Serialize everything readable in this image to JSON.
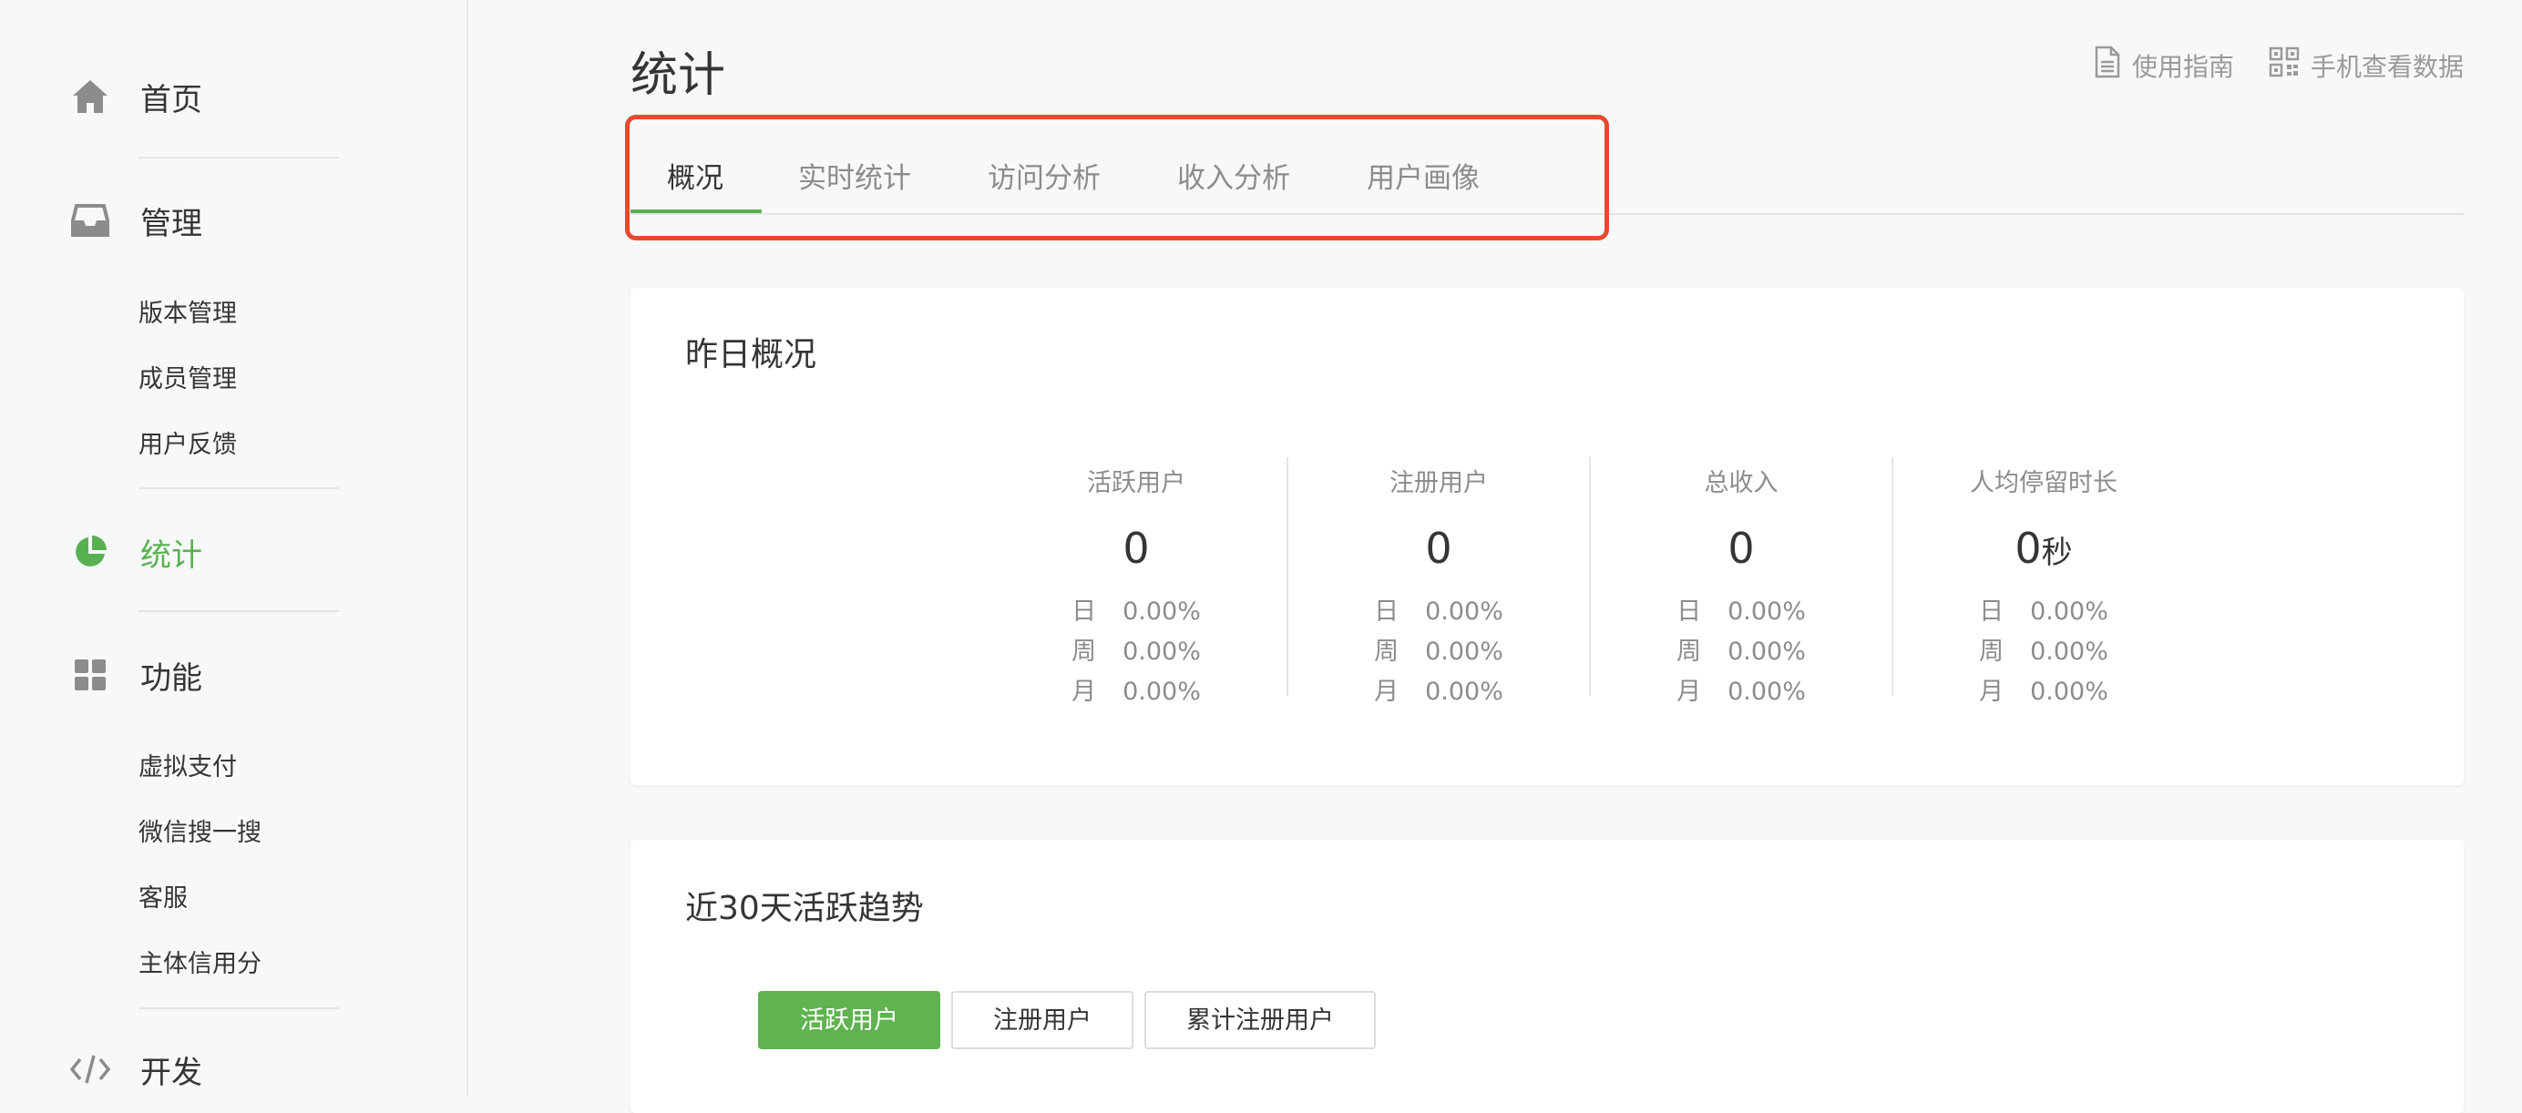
{
  "sidebar": {
    "home": "首页",
    "manage": "管理",
    "manage_items": [
      "版本管理",
      "成员管理",
      "用户反馈"
    ],
    "stats": "统计",
    "features": "功能",
    "feature_items": [
      "虚拟支付",
      "微信搜一搜",
      "客服",
      "主体信用分"
    ],
    "dev": "开发"
  },
  "header": {
    "title": "统计",
    "guide_link": "使用指南",
    "mobile_link": "手机查看数据"
  },
  "tabs": [
    "概况",
    "实时统计",
    "访问分析",
    "收入分析",
    "用户画像"
  ],
  "active_tab": 0,
  "overview": {
    "title": "昨日概况",
    "metrics": [
      {
        "label": "活跃用户",
        "value": "0",
        "unit": "",
        "day_k": "日",
        "day": "0.00%",
        "week_k": "周",
        "week": "0.00%",
        "month_k": "月",
        "month": "0.00%"
      },
      {
        "label": "注册用户",
        "value": "0",
        "unit": "",
        "day_k": "日",
        "day": "0.00%",
        "week_k": "周",
        "week": "0.00%",
        "month_k": "月",
        "month": "0.00%"
      },
      {
        "label": "总收入",
        "value": "0",
        "unit": "",
        "day_k": "日",
        "day": "0.00%",
        "week_k": "周",
        "week": "0.00%",
        "month_k": "月",
        "month": "0.00%"
      },
      {
        "label": "人均停留时长",
        "value": "0",
        "unit": "秒",
        "day_k": "日",
        "day": "0.00%",
        "week_k": "周",
        "week": "0.00%",
        "month_k": "月",
        "month": "0.00%"
      }
    ]
  },
  "trend": {
    "title": "近30天活跃趋势",
    "buttons": [
      "活跃用户",
      "注册用户",
      "累计注册用户"
    ],
    "active_button": 0
  },
  "colors": {
    "accent": "#58b150",
    "highlight": "#e64a2e",
    "text": "#353535",
    "muted": "#8c8c8c"
  },
  "icons": [
    "home-icon",
    "inbox-icon",
    "pie-chart-icon",
    "grid-icon",
    "code-icon",
    "document-icon",
    "qrcode-icon"
  ]
}
